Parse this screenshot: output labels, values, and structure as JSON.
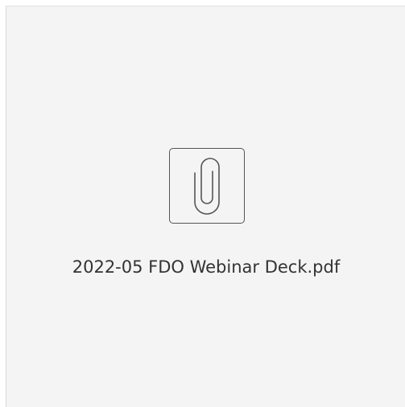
{
  "attachment": {
    "file_name": "2022-05 FDO Webinar Deck.pdf",
    "icon": "paperclip-icon"
  }
}
